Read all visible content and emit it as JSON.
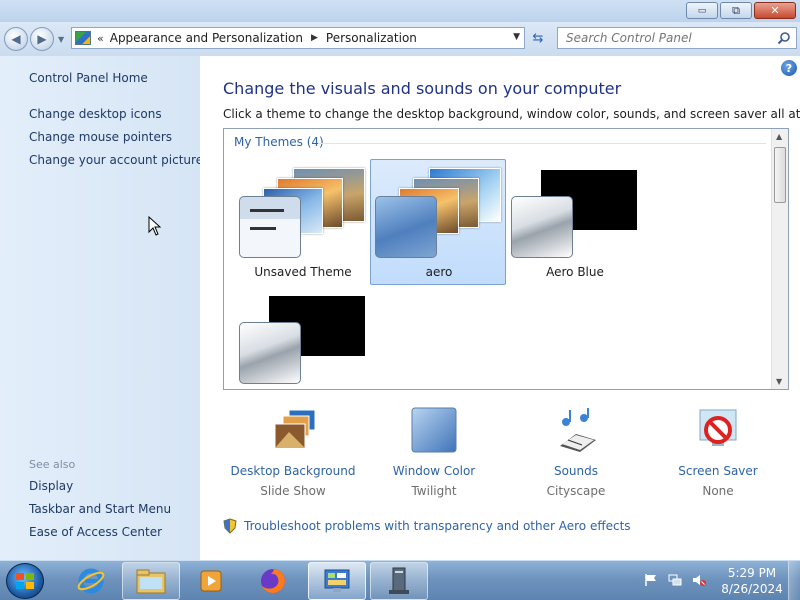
{
  "window": {
    "minimize_glyph": "▭",
    "maximize_glyph": "⧉",
    "close_glyph": "✕"
  },
  "navigation": {
    "back_glyph": "◀",
    "forward_glyph": "▶",
    "recent_glyph": "▼",
    "address_prefix": "«",
    "breadcrumbs": [
      "Appearance and Personalization",
      "Personalization"
    ],
    "separator_glyph": "▶",
    "address_dropdown_glyph": "▼",
    "refresh_glyph": "⇆"
  },
  "search": {
    "placeholder": "Search Control Panel",
    "icon": "magnifier-icon"
  },
  "left_pane": {
    "home_link": "Control Panel Home",
    "task_links": [
      "Change desktop icons",
      "Change mouse pointers",
      "Change your account picture"
    ],
    "see_also_label": "See also",
    "see_also_links": [
      "Display",
      "Taskbar and Start Menu",
      "Ease of Access Center"
    ]
  },
  "main": {
    "help_glyph": "?",
    "heading": "Change the visuals and sounds on your computer",
    "subtext": "Click a theme to change the desktop background, window color, sounds, and screen saver all at once.",
    "themes_group": "My Themes (4)",
    "themes": [
      {
        "name": "Unsaved Theme",
        "selected": false
      },
      {
        "name": "aero",
        "selected": true
      },
      {
        "name": "Aero Blue",
        "selected": false
      },
      {
        "name": "",
        "selected": false
      }
    ],
    "scroll_up_glyph": "▲",
    "scroll_down_glyph": "▼",
    "settings": [
      {
        "title": "Desktop Background",
        "value": "Slide Show",
        "icon": "desktop-background-icon"
      },
      {
        "title": "Window Color",
        "value": "Twilight",
        "icon": "window-color-icon"
      },
      {
        "title": "Sounds",
        "value": "Cityscape",
        "icon": "sounds-icon"
      },
      {
        "title": "Screen Saver",
        "value": "None",
        "icon": "screen-saver-icon"
      }
    ],
    "troubleshoot_link": "Troubleshoot problems with transparency and other Aero effects"
  },
  "taskbar": {
    "apps": [
      "internet-explorer-icon",
      "file-explorer-icon",
      "media-player-icon",
      "firefox-icon",
      "control-panel-icon",
      "system-icon"
    ],
    "clock_time": "5:29 PM",
    "clock_date": "8/26/2024"
  },
  "colors": {
    "link": "#2e63a8",
    "heading": "#1e3287",
    "selection": "#c1dcfc"
  }
}
